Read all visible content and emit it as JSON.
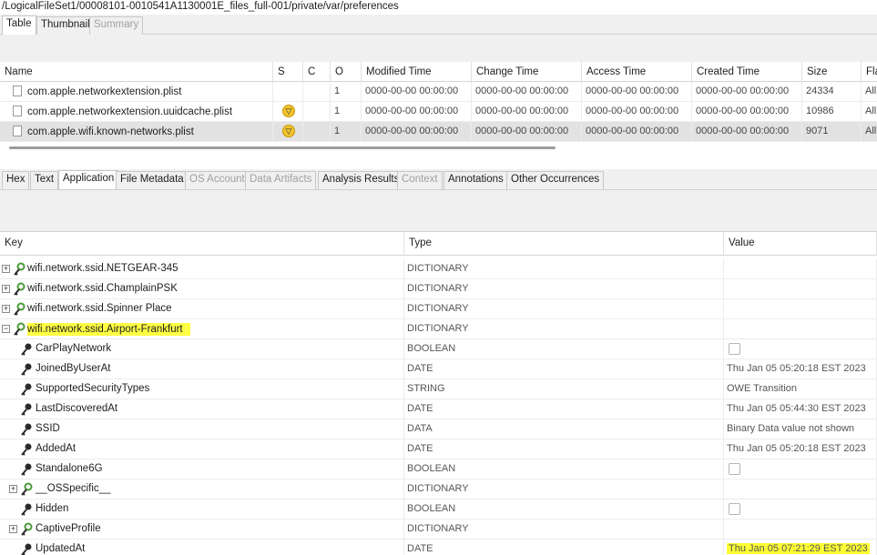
{
  "path": "/LogicalFileSet1/00008101-0010541A1130001E_files_full-001/private/var/preferences",
  "top_tabs": [
    {
      "label": "Table",
      "state": "active"
    },
    {
      "label": "Thumbnail",
      "state": "normal"
    },
    {
      "label": "Summary",
      "state": "disabled"
    }
  ],
  "file_table": {
    "columns": [
      "Name",
      "S",
      "C",
      "O",
      "Modified Time",
      "Change Time",
      "Access Time",
      "Created Time",
      "Size",
      "Fla"
    ],
    "rows": [
      {
        "name": "com.apple.networkextension.plist",
        "warn": false,
        "o": "1",
        "modified": "0000-00-00 00:00:00",
        "change": "0000-00-00 00:00:00",
        "access": "0000-00-00 00:00:00",
        "created": "0000-00-00 00:00:00",
        "size": "24334",
        "flag": "All"
      },
      {
        "name": "com.apple.networkextension.uuidcache.plist",
        "warn": true,
        "o": "1",
        "modified": "0000-00-00 00:00:00",
        "change": "0000-00-00 00:00:00",
        "access": "0000-00-00 00:00:00",
        "created": "0000-00-00 00:00:00",
        "size": "10986",
        "flag": "All"
      },
      {
        "name": "com.apple.wifi.known-networks.plist",
        "warn": true,
        "o": "1",
        "modified": "0000-00-00 00:00:00",
        "change": "0000-00-00 00:00:00",
        "access": "0000-00-00 00:00:00",
        "created": "0000-00-00 00:00:00",
        "size": "9071",
        "flag": "All"
      }
    ]
  },
  "viewer_tabs": [
    {
      "label": "Hex",
      "state": "normal"
    },
    {
      "label": "Text",
      "state": "normal"
    },
    {
      "label": "Application",
      "state": "active"
    },
    {
      "label": "File Metadata",
      "state": "normal"
    },
    {
      "label": "OS Account",
      "state": "disabled"
    },
    {
      "label": "Data Artifacts",
      "state": "disabled"
    },
    {
      "label": "Analysis Results",
      "state": "normal"
    },
    {
      "label": "Context",
      "state": "disabled"
    },
    {
      "label": "Annotations",
      "state": "normal"
    },
    {
      "label": "Other Occurrences",
      "state": "normal"
    }
  ],
  "plist_table": {
    "columns": [
      "Key",
      "Type",
      "Value"
    ],
    "rows": [
      {
        "key": "wifi.network.ssid.NETGEAR-345",
        "type": "DICTIONARY",
        "value": "",
        "level": 0,
        "expander": "+",
        "icon": "dictionary-key-icon"
      },
      {
        "key": "wifi.network.ssid.ChamplainPSK",
        "type": "DICTIONARY",
        "value": "",
        "level": 0,
        "expander": "+",
        "icon": "dictionary-key-icon"
      },
      {
        "key": "wifi.network.ssid.Spinner Place",
        "type": "DICTIONARY",
        "value": "",
        "level": 0,
        "expander": "+",
        "icon": "dictionary-key-icon"
      },
      {
        "key": "wifi.network.ssid.Airport-Frankfurt",
        "type": "DICTIONARY",
        "value": "",
        "level": 0,
        "expander": "-",
        "icon": "dictionary-key-icon",
        "highlight": true
      },
      {
        "key": "CarPlayNetwork",
        "type": "BOOLEAN",
        "value": "",
        "level": 1,
        "checkbox": true,
        "icon": "key-icon"
      },
      {
        "key": "JoinedByUserAt",
        "type": "DATE",
        "value": "Thu Jan 05 05:20:18 EST 2023",
        "level": 1,
        "icon": "key-icon"
      },
      {
        "key": "SupportedSecurityTypes",
        "type": "STRING",
        "value": "OWE Transition",
        "level": 1,
        "icon": "key-icon"
      },
      {
        "key": "LastDiscoveredAt",
        "type": "DATE",
        "value": "Thu Jan 05 05:44:30 EST 2023",
        "level": 1,
        "icon": "key-icon"
      },
      {
        "key": "SSID",
        "type": "DATA",
        "value": "Binary Data value not shown",
        "level": 1,
        "icon": "key-icon"
      },
      {
        "key": "AddedAt",
        "type": "DATE",
        "value": "Thu Jan 05 05:20:18 EST 2023",
        "level": 1,
        "icon": "key-icon"
      },
      {
        "key": "Standalone6G",
        "type": "BOOLEAN",
        "value": "",
        "level": 1,
        "checkbox": true,
        "icon": "key-icon"
      },
      {
        "key": "__OSSpecific__",
        "type": "DICTIONARY",
        "value": "",
        "level": 1,
        "expander": "+",
        "icon": "dictionary-key-icon"
      },
      {
        "key": "Hidden",
        "type": "BOOLEAN",
        "value": "",
        "level": 1,
        "checkbox": true,
        "icon": "key-icon"
      },
      {
        "key": "CaptiveProfile",
        "type": "DICTIONARY",
        "value": "",
        "level": 1,
        "expander": "+",
        "icon": "dictionary-key-icon"
      },
      {
        "key": "UpdatedAt",
        "type": "DATE",
        "value": "Thu Jan 05 07:21:29 EST 2023",
        "level": 1,
        "icon": "key-icon",
        "value_highlight": true
      }
    ]
  },
  "colors": {
    "highlight": "#ffff33",
    "warning": "#f4c430",
    "key_icon_green": "#4a9a3a",
    "key_icon_dark": "#2a2a2a",
    "selected_row": "#e2e2e2"
  }
}
